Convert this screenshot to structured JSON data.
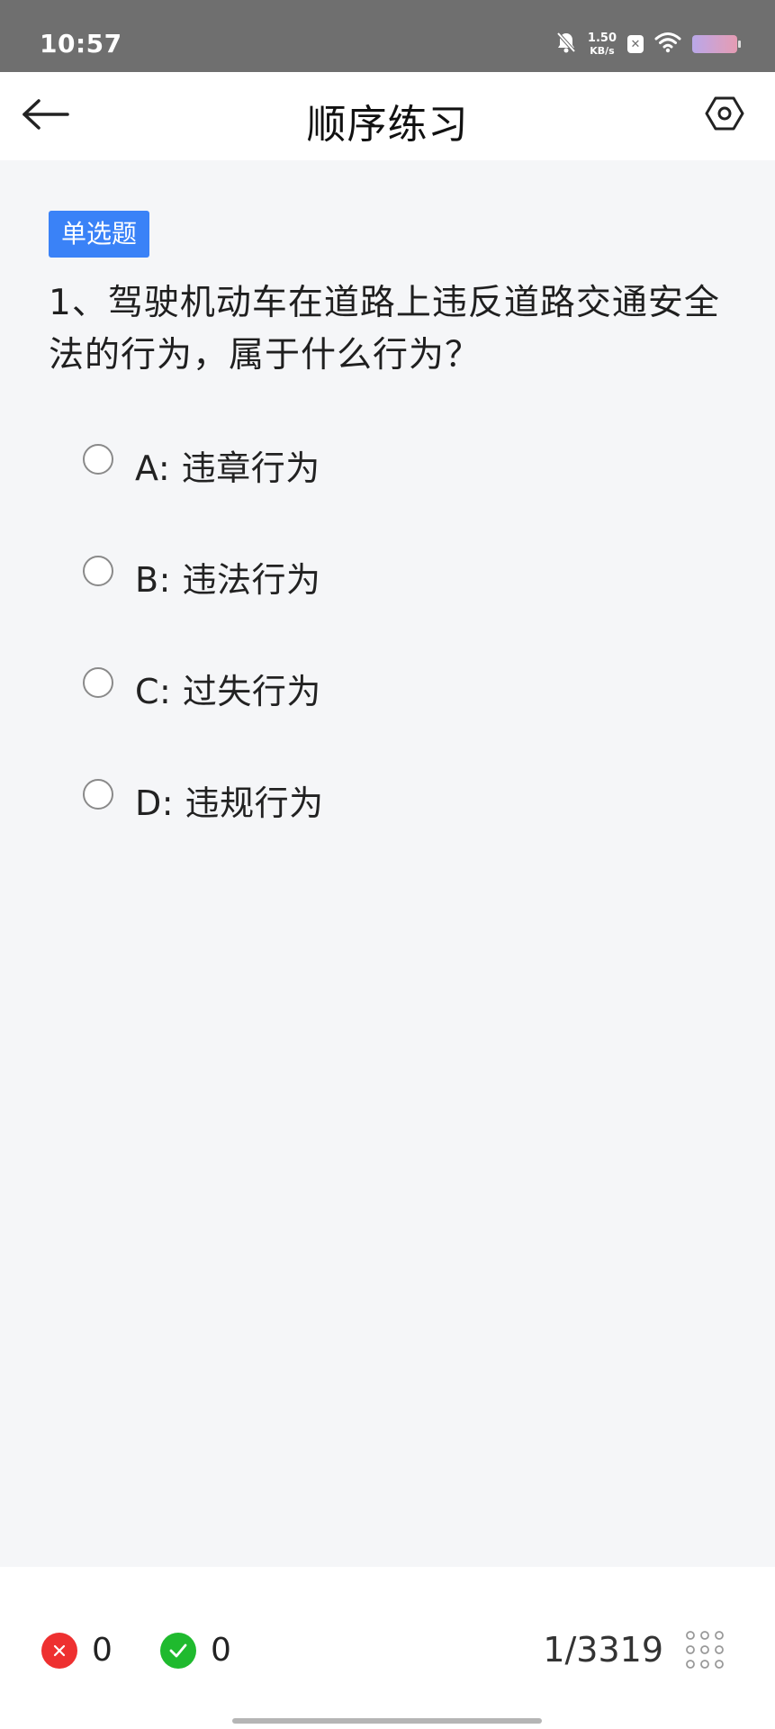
{
  "status_bar": {
    "time": "10:57",
    "net_speed_value": "1.50",
    "net_speed_unit": "KB/s",
    "icons": [
      "bell-off-icon",
      "close-box-icon",
      "wifi-icon",
      "battery-icon"
    ]
  },
  "header": {
    "title": "顺序练习",
    "back_icon": "back-arrow-icon",
    "settings_icon": "settings-hex-icon"
  },
  "question": {
    "type_label": "单选题",
    "number_prefix": "1、",
    "text": "驾驶机动车在道路上违反道路交通安全法的行为，属于什么行为？",
    "options": [
      {
        "label": "A: 违章行为"
      },
      {
        "label": "B: 违法行为"
      },
      {
        "label": "C: 过失行为"
      },
      {
        "label": "D: 违规行为"
      }
    ]
  },
  "footer": {
    "wrong_count": "0",
    "right_count": "0",
    "progress": "1/3319",
    "wrong_icon": "close-icon",
    "right_icon": "check-icon",
    "grid_icon": "grid-dots-icon"
  },
  "colors": {
    "accent_blue": "#3a82f7",
    "wrong_red": "#ee3030",
    "right_green": "#1fba2e",
    "background": "#f5f6f8",
    "status_bar": "#6f6f6f"
  }
}
